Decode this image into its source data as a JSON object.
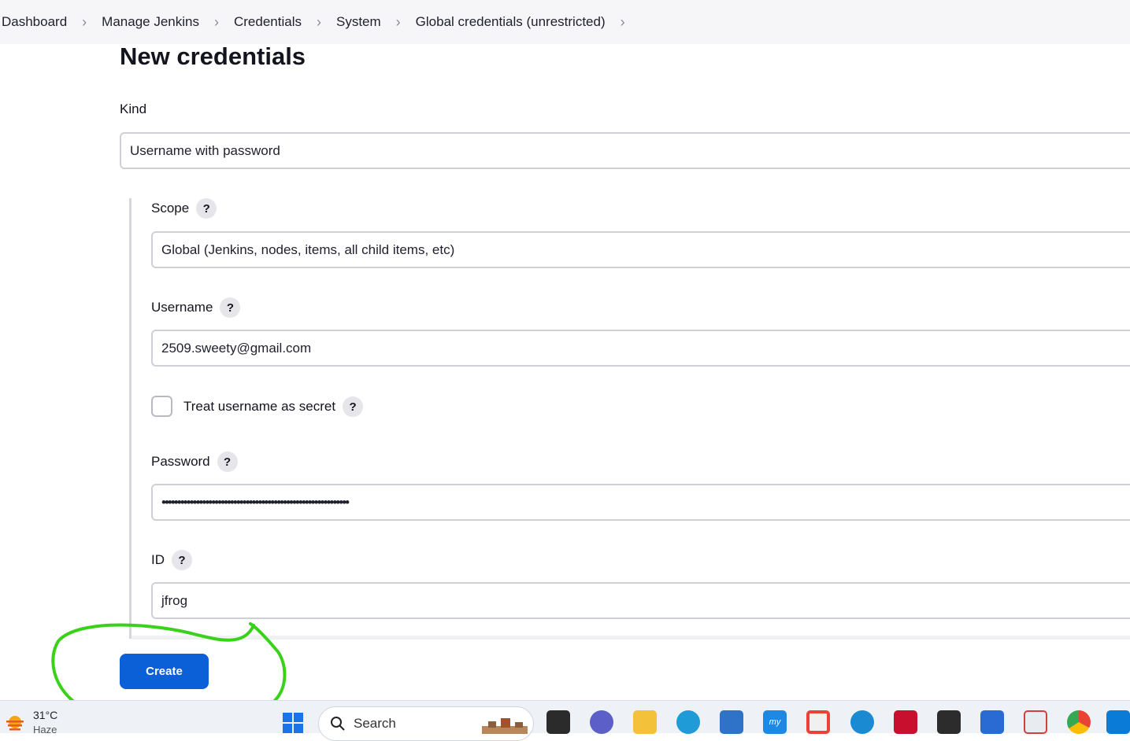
{
  "breadcrumb": {
    "items": [
      "Dashboard",
      "Manage Jenkins",
      "Credentials",
      "System",
      "Global credentials (unrestricted)"
    ],
    "separator": ">"
  },
  "page": {
    "title": "New credentials"
  },
  "form": {
    "kind": {
      "label": "Kind",
      "value": "Username with password"
    },
    "scope": {
      "label": "Scope",
      "value": "Global (Jenkins, nodes, items, all child items, etc)",
      "help": "?"
    },
    "username": {
      "label": "Username",
      "value": "2509.sweety@gmail.com",
      "help": "?"
    },
    "treat_secret": {
      "label": "Treat username as secret",
      "checked": false,
      "help": "?"
    },
    "password": {
      "label": "Password",
      "value": "••••••••••••••••••••••••••••••••••••••••••••••••••••••••••••",
      "help": "?"
    },
    "id": {
      "label": "ID",
      "value": "jfrog",
      "help": "?"
    },
    "create_label": "Create"
  },
  "taskbar": {
    "weather": {
      "temp": "31°C",
      "desc": "Haze"
    },
    "search_placeholder": "Search",
    "pinned": [
      "file-explorer-icon",
      "teams-icon",
      "folder-icon",
      "edge-icon",
      "store-icon",
      "myhp-icon",
      "git-icon",
      "help-icon",
      "mcafee-icon",
      "terminal-icon",
      "powershell-icon",
      "snipping-tool-icon",
      "chrome-icon",
      "vscode-icon"
    ]
  },
  "colors": {
    "accent": "#0b5fd7",
    "annotation": "#39d11a"
  }
}
